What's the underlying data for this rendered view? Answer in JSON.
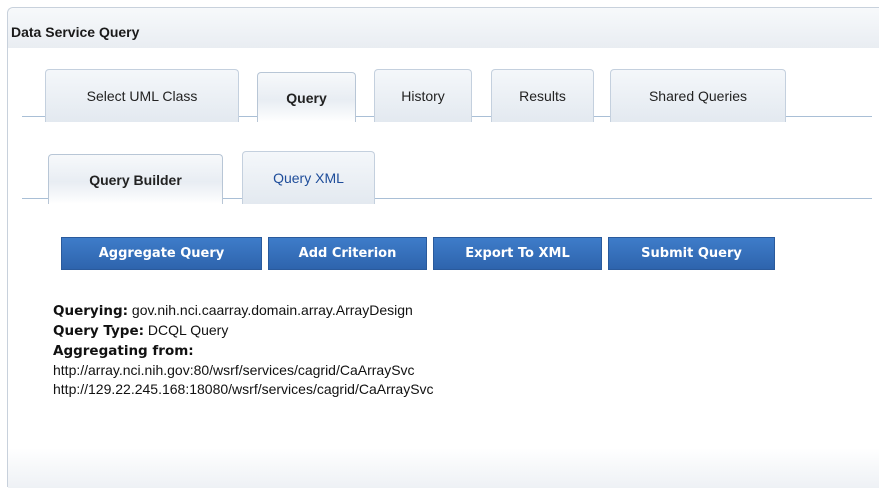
{
  "panel": {
    "title": "Data Service Query"
  },
  "main_tabs": [
    {
      "label": "Select UML Class",
      "active": false
    },
    {
      "label": "Query",
      "active": true
    },
    {
      "label": "History",
      "active": false
    },
    {
      "label": "Results",
      "active": false
    },
    {
      "label": "Shared Queries",
      "active": false
    }
  ],
  "sub_tabs": [
    {
      "label": "Query Builder",
      "active": true
    },
    {
      "label": "Query XML",
      "active": false
    }
  ],
  "actions": {
    "aggregate_query": "Aggregate Query",
    "add_criterion": "Add Criterion",
    "export_to_xml": "Export To XML",
    "submit_query": "Submit Query"
  },
  "info": {
    "querying_label": "Querying:",
    "querying_value": "gov.nih.nci.caarray.domain.array.ArrayDesign",
    "query_type_label": "Query Type:",
    "query_type_value": "DCQL Query",
    "aggregating_label": "Aggregating from:",
    "sources": [
      "http://array.nci.nih.gov:80/wsrf/services/cagrid/CaArraySvc",
      "http://129.22.245.168:18080/wsrf/services/cagrid/CaArraySvc"
    ]
  },
  "colors": {
    "button_blue": "#2e64ad",
    "tab_link_blue": "#1e4d9a",
    "tab_border": "#a9bfd6"
  }
}
